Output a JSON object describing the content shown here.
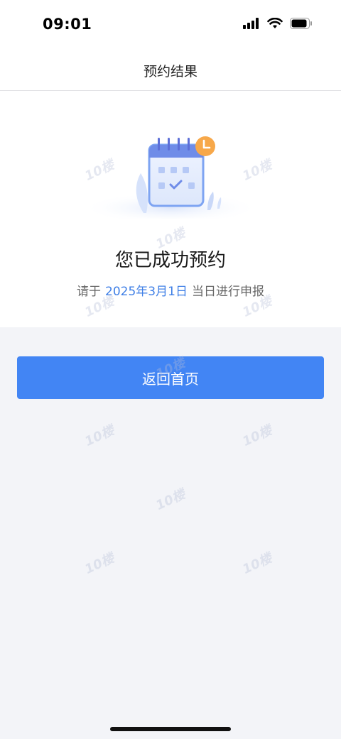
{
  "status_bar": {
    "time": "09:01"
  },
  "nav": {
    "title": "预约结果"
  },
  "result": {
    "title": "您已成功预约",
    "sub_prefix": "请于",
    "date": "2025年3月1日",
    "sub_suffix": "当日进行申报"
  },
  "actions": {
    "home_label": "返回首页"
  },
  "watermark": "10楼",
  "colors": {
    "primary": "#4285f4",
    "date_text": "#3f7fe6",
    "page_bg": "#f3f4f8"
  }
}
